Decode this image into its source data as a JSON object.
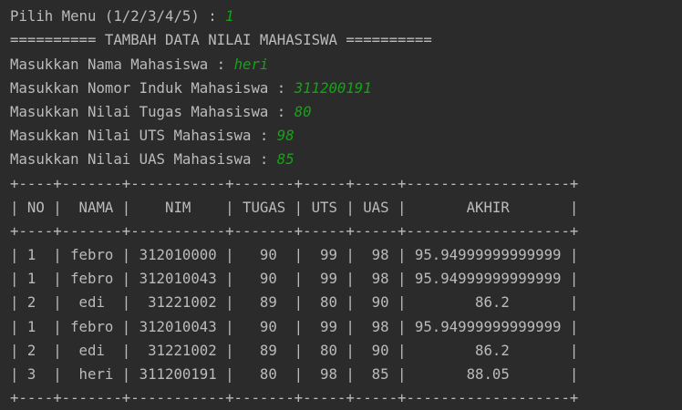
{
  "console": {
    "lines": [
      {
        "prompt": "Pilih Menu (1/2/3/4/5) : ",
        "input": "1"
      },
      {
        "prompt": "========== TAMBAH DATA NILAI MAHASISWA ==========",
        "input": ""
      },
      {
        "prompt": "Masukkan Nama Mahasiswa : ",
        "input": "heri"
      },
      {
        "prompt": "Masukkan Nomor Induk Mahasiswa : ",
        "input": "311200191"
      },
      {
        "prompt": "Masukkan Nilai Tugas Mahasiswa : ",
        "input": "80"
      },
      {
        "prompt": "Masukkan Nilai UTS Mahasiswa : ",
        "input": "98"
      },
      {
        "prompt": "Masukkan Nilai UAS Mahasiswa : ",
        "input": "85"
      },
      {
        "prompt": "+----+-------+-----------+-------+-----+-----+-------------------+",
        "input": ""
      },
      {
        "prompt": "| NO |  NAMA |    NIM    | TUGAS | UTS | UAS |       AKHIR       |",
        "input": ""
      },
      {
        "prompt": "+----+-------+-----------+-------+-----+-----+-------------------+",
        "input": ""
      },
      {
        "prompt": "| 1  | febro | 312010000 |   90  |  99 |  98 | 95.94999999999999 |",
        "input": ""
      },
      {
        "prompt": "| 1  | febro | 312010043 |   90  |  99 |  98 | 95.94999999999999 |",
        "input": ""
      },
      {
        "prompt": "| 2  |  edi  |  31221002 |   89  |  80 |  90 |        86.2       |",
        "input": ""
      },
      {
        "prompt": "| 1  | febro | 312010043 |   90  |  99 |  98 | 95.94999999999999 |",
        "input": ""
      },
      {
        "prompt": "| 2  |  edi  |  31221002 |   89  |  80 |  90 |        86.2       |",
        "input": ""
      },
      {
        "prompt": "| 3  |  heri | 311200191 |   80  |  98 |  85 |       88.05       |",
        "input": ""
      },
      {
        "prompt": "+----+-------+-----------+-------+-----+-----+-------------------+",
        "input": ""
      }
    ]
  }
}
